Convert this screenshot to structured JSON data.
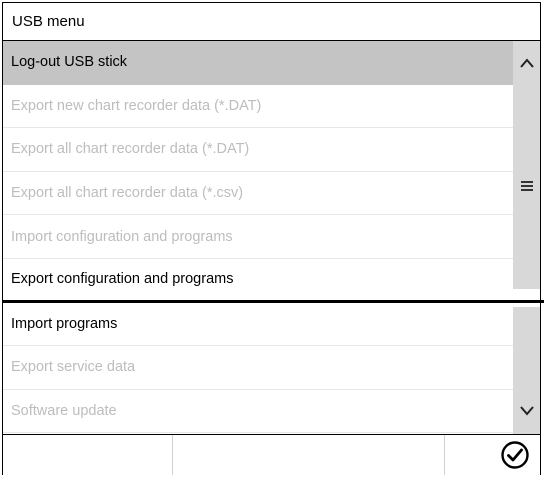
{
  "window": {
    "title": "USB menu"
  },
  "menu": {
    "items": [
      {
        "label": "Log-out USB stick",
        "state": "selected"
      },
      {
        "label": "Export new chart recorder data (*.DAT)",
        "state": "disabled"
      },
      {
        "label": "Export all chart recorder data (*.DAT)",
        "state": "disabled"
      },
      {
        "label": "Export all chart recorder data (*.csv)",
        "state": "disabled"
      },
      {
        "label": "Import configuration and programs",
        "state": "disabled"
      },
      {
        "label": "Export configuration and programs",
        "state": "enabled"
      },
      {
        "label": "Import programs",
        "state": "enabled"
      },
      {
        "label": "Export service data",
        "state": "disabled"
      },
      {
        "label": "Software update",
        "state": "disabled"
      }
    ]
  },
  "scrollbar": {
    "up_icon": "chevron-up-icon",
    "grip_icon": "grip-lines-icon",
    "down_icon": "chevron-down-icon"
  },
  "footer": {
    "confirm_icon": "check-circle-icon"
  },
  "colors": {
    "selected_row": "#c4c4c4",
    "disabled_text": "#bdbdbd",
    "scrollbar": "#d8d8d8",
    "border": "#000000"
  }
}
